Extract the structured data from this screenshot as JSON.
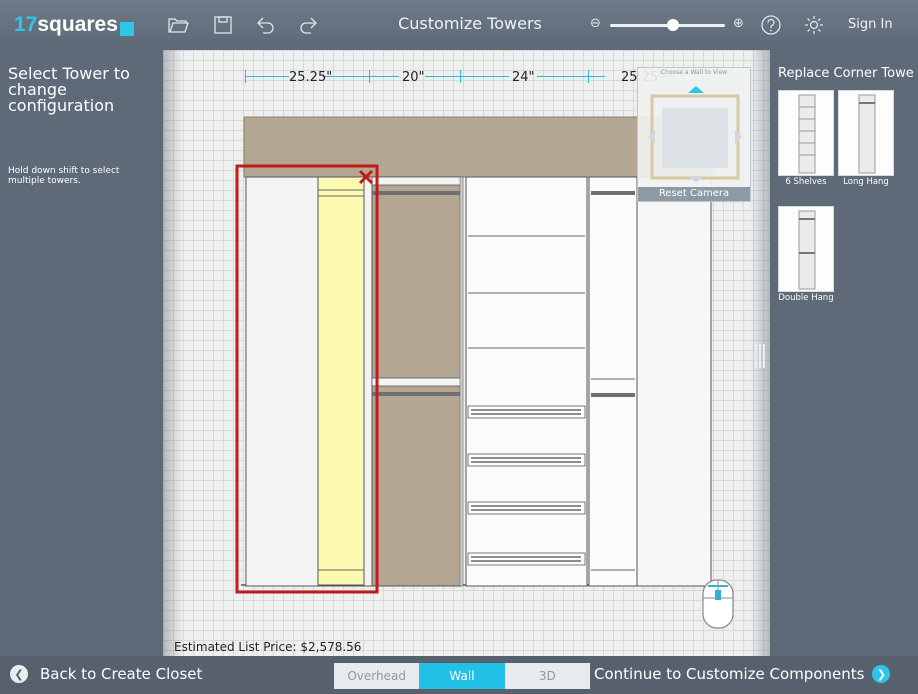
{
  "app": {
    "logo_num": "17",
    "logo_word": "squares",
    "page_title": "Customize Towers",
    "sign_in": "Sign In"
  },
  "toolbar": {
    "icons": [
      "folder-open-icon",
      "save-icon",
      "undo-icon",
      "redo-icon",
      "zoom-out-icon",
      "zoom-in-icon",
      "help-icon",
      "settings-icon"
    ],
    "zoom_level": 0.55
  },
  "left_panel": {
    "title": "Select Tower to change configuration",
    "hint": "Hold down shift to select multiple towers."
  },
  "right_panel": {
    "title": "Replace Corner Towe",
    "options": [
      {
        "label": "6 Shelves"
      },
      {
        "label": "Long Hang"
      },
      {
        "label": "Double Hang"
      }
    ]
  },
  "canvas": {
    "dimensions": [
      "25.25\"",
      "20\"",
      "24\"",
      "25.25\""
    ],
    "view_picker_title": "Choose a Wall to View",
    "reset_camera": "Reset Camera",
    "estimated_price": "Estimated List Price: $2,578.56"
  },
  "bottom": {
    "back_label": "Back to Create Closet",
    "continue_label": "Continue to Customize Components",
    "view_tabs": [
      {
        "label": "Overhead",
        "active": false
      },
      {
        "label": "Wall",
        "active": true
      },
      {
        "label": "3D",
        "active": false
      }
    ]
  },
  "colors": {
    "accent": "#2ec6e8",
    "selection": "#c21a1a",
    "highlight": "#fbfab0",
    "wood": "#b3a692"
  }
}
